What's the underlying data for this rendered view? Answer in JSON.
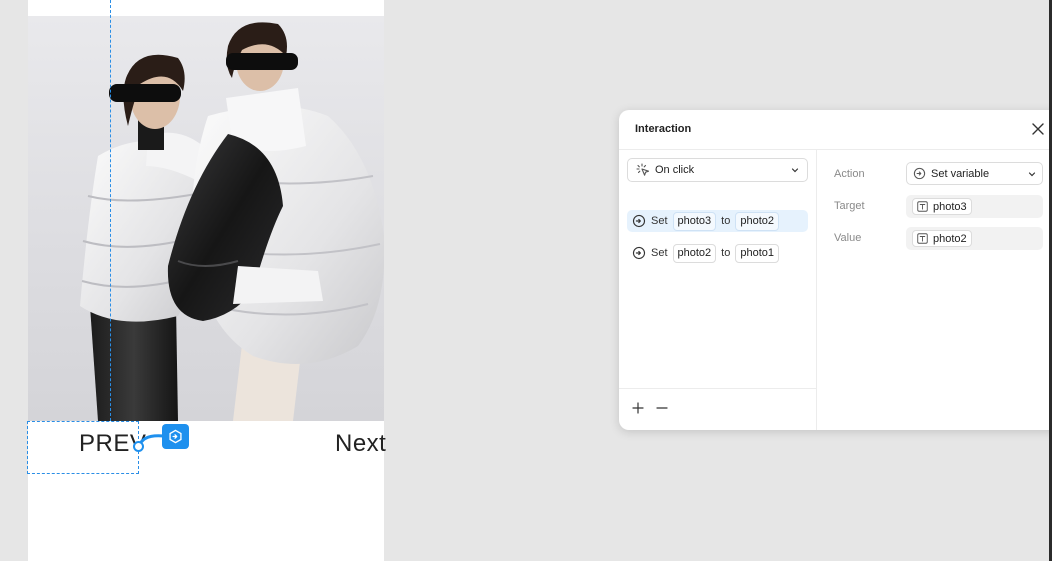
{
  "canvas": {
    "prev_label": "PREV",
    "next_label": "Next"
  },
  "panel": {
    "title": "Interaction",
    "trigger": "On click",
    "interactions": [
      {
        "verb": "Set",
        "target": "photo3",
        "connector": "to",
        "value": "photo2",
        "selected": true
      },
      {
        "verb": "Set",
        "target": "photo2",
        "connector": "to",
        "value": "photo1",
        "selected": false
      }
    ],
    "properties": {
      "action_label": "Action",
      "action_value": "Set variable",
      "target_label": "Target",
      "target_value": "photo3",
      "value_label": "Value",
      "value_value": "photo2"
    }
  },
  "colors": {
    "accent": "#1e90ee",
    "selection_bg": "#e6f2fd",
    "canvas_bg": "#e6e6e6"
  }
}
